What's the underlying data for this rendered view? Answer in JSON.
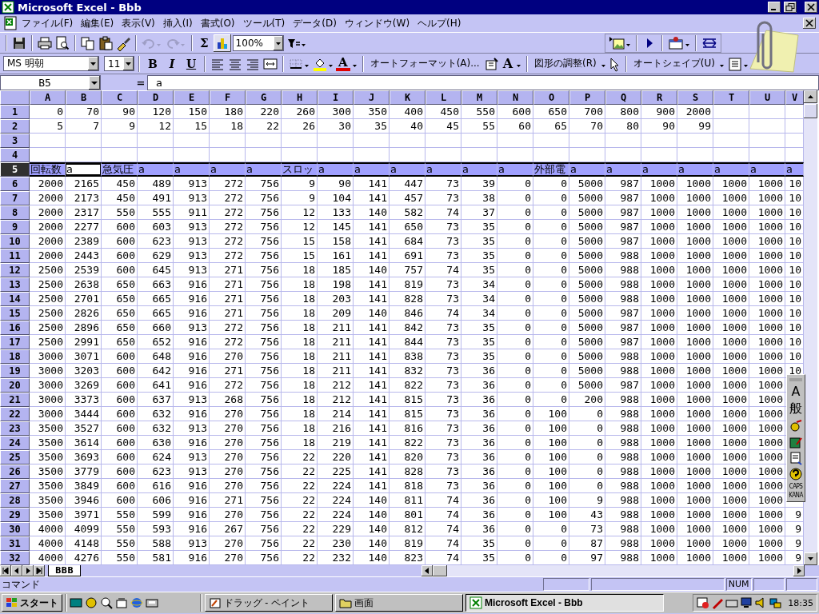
{
  "window": {
    "title": "Microsoft Excel - Bbb"
  },
  "menu": [
    "ファイル(F)",
    "編集(E)",
    "表示(V)",
    "挿入(I)",
    "書式(O)",
    "ツール(T)",
    "データ(D)",
    "ウィンドウ(W)",
    "ヘルプ(H)"
  ],
  "standard_toolbar": {
    "undo": {
      "disabled": true
    },
    "redo": {
      "disabled": true
    },
    "autosum": "Σ",
    "zoom": "100%"
  },
  "formatting_toolbar": {
    "font": "MS 明朝",
    "size": "11",
    "bold": "B",
    "italic": "I",
    "underline": "U",
    "font_color": "A",
    "autoformat": "オートフォーマット(A)...",
    "font_size": "A",
    "adjust": "図形の調整(R)",
    "autoshape": "オートシェイプ(U)"
  },
  "formula_bar": {
    "name_box": "B5",
    "equals": "=",
    "value": "a"
  },
  "sheet": {
    "columns": [
      "A",
      "B",
      "C",
      "D",
      "E",
      "F",
      "G",
      "H",
      "I",
      "J",
      "K",
      "L",
      "M",
      "N",
      "O",
      "P",
      "Q",
      "R",
      "S",
      "T",
      "U",
      "V"
    ],
    "rows": [
      {
        "number": "1",
        "selected": false,
        "kind": "numbers",
        "cells": [
          "0",
          "70",
          "90",
          "120",
          "150",
          "180",
          "220",
          "260",
          "300",
          "350",
          "400",
          "450",
          "550",
          "600",
          "650",
          "700",
          "800",
          "900",
          "2000"
        ]
      },
      {
        "number": "2",
        "selected": false,
        "kind": "numbers",
        "cells": [
          "5",
          "7",
          "9",
          "12",
          "15",
          "18",
          "22",
          "26",
          "30",
          "35",
          "40",
          "45",
          "55",
          "60",
          "65",
          "70",
          "80",
          "90",
          "99"
        ]
      },
      {
        "number": "3",
        "selected": false,
        "kind": "numbers"
      },
      {
        "number": "4",
        "selected": false,
        "kind": "numbers"
      },
      {
        "number": "5",
        "selected": true,
        "kind": "labels",
        "cells": [
          {
            "text": "回転数",
            "active": false
          },
          {
            "text": "a",
            "active": true
          },
          {
            "text": "急気圧",
            "active": false
          },
          {
            "text": "a",
            "active": false
          },
          {
            "text": "a",
            "active": false
          },
          {
            "text": "a",
            "active": false
          },
          {
            "text": "a",
            "active": false
          },
          {
            "text": "スロッ",
            "active": false
          },
          {
            "text": "a",
            "active": false
          },
          {
            "text": "a",
            "active": false
          },
          {
            "text": "a",
            "active": false
          },
          {
            "text": "a",
            "active": false
          },
          {
            "text": "a",
            "active": false
          },
          {
            "text": "a",
            "active": false
          },
          {
            "text": "外部電",
            "active": false
          },
          {
            "text": "a",
            "active": false
          },
          {
            "text": "a",
            "active": false
          },
          {
            "text": "a",
            "active": false
          },
          {
            "text": "a",
            "active": false
          },
          {
            "text": "a",
            "active": false
          },
          {
            "text": "a",
            "active": false
          },
          {
            "text": "a",
            "active": false
          }
        ]
      },
      {
        "number": "6",
        "selected": false,
        "kind": "numbers",
        "cells": [
          "2000",
          "2165",
          "450",
          "489",
          "913",
          "272",
          "756",
          "9",
          "90",
          "141",
          "447",
          "73",
          "39",
          "0",
          "0",
          "5000",
          "987",
          "1000",
          "1000",
          "1000",
          "1000",
          "10"
        ]
      },
      {
        "number": "7",
        "selected": false,
        "kind": "numbers",
        "cells": [
          "2000",
          "2173",
          "450",
          "491",
          "913",
          "272",
          "756",
          "9",
          "104",
          "141",
          "457",
          "73",
          "38",
          "0",
          "0",
          "5000",
          "987",
          "1000",
          "1000",
          "1000",
          "1000",
          "10"
        ]
      },
      {
        "number": "8",
        "selected": false,
        "kind": "numbers",
        "cells": [
          "2000",
          "2317",
          "550",
          "555",
          "911",
          "272",
          "756",
          "12",
          "133",
          "140",
          "582",
          "74",
          "37",
          "0",
          "0",
          "5000",
          "987",
          "1000",
          "1000",
          "1000",
          "1000",
          "10"
        ]
      },
      {
        "number": "9",
        "selected": false,
        "kind": "numbers",
        "cells": [
          "2000",
          "2277",
          "600",
          "603",
          "913",
          "272",
          "756",
          "12",
          "145",
          "141",
          "650",
          "73",
          "35",
          "0",
          "0",
          "5000",
          "987",
          "1000",
          "1000",
          "1000",
          "1000",
          "10"
        ]
      },
      {
        "number": "10",
        "selected": false,
        "kind": "numbers",
        "cells": [
          "2000",
          "2389",
          "600",
          "623",
          "913",
          "272",
          "756",
          "15",
          "158",
          "141",
          "684",
          "73",
          "35",
          "0",
          "0",
          "5000",
          "987",
          "1000",
          "1000",
          "1000",
          "1000",
          "10"
        ]
      },
      {
        "number": "11",
        "selected": false,
        "kind": "numbers",
        "cells": [
          "2000",
          "2443",
          "600",
          "629",
          "913",
          "272",
          "756",
          "15",
          "161",
          "141",
          "691",
          "73",
          "35",
          "0",
          "0",
          "5000",
          "988",
          "1000",
          "1000",
          "1000",
          "1000",
          "10"
        ]
      },
      {
        "number": "12",
        "selected": false,
        "kind": "numbers",
        "cells": [
          "2500",
          "2539",
          "600",
          "645",
          "913",
          "271",
          "756",
          "18",
          "185",
          "140",
          "757",
          "74",
          "35",
          "0",
          "0",
          "5000",
          "988",
          "1000",
          "1000",
          "1000",
          "1000",
          "10"
        ]
      },
      {
        "number": "13",
        "selected": false,
        "kind": "numbers",
        "cells": [
          "2500",
          "2638",
          "650",
          "663",
          "916",
          "271",
          "756",
          "18",
          "198",
          "141",
          "819",
          "73",
          "34",
          "0",
          "0",
          "5000",
          "988",
          "1000",
          "1000",
          "1000",
          "1000",
          "10"
        ]
      },
      {
        "number": "14",
        "selected": false,
        "kind": "numbers",
        "cells": [
          "2500",
          "2701",
          "650",
          "665",
          "916",
          "271",
          "756",
          "18",
          "203",
          "141",
          "828",
          "73",
          "34",
          "0",
          "0",
          "5000",
          "988",
          "1000",
          "1000",
          "1000",
          "1000",
          "10"
        ]
      },
      {
        "number": "15",
        "selected": false,
        "kind": "numbers",
        "cells": [
          "2500",
          "2826",
          "650",
          "665",
          "916",
          "271",
          "756",
          "18",
          "209",
          "140",
          "846",
          "74",
          "34",
          "0",
          "0",
          "5000",
          "987",
          "1000",
          "1000",
          "1000",
          "1000",
          "10"
        ]
      },
      {
        "number": "16",
        "selected": false,
        "kind": "numbers",
        "cells": [
          "2500",
          "2896",
          "650",
          "660",
          "913",
          "272",
          "756",
          "18",
          "211",
          "141",
          "842",
          "73",
          "35",
          "0",
          "0",
          "5000",
          "987",
          "1000",
          "1000",
          "1000",
          "1000",
          "10"
        ]
      },
      {
        "number": "17",
        "selected": false,
        "kind": "numbers",
        "cells": [
          "2500",
          "2991",
          "650",
          "652",
          "916",
          "272",
          "756",
          "18",
          "211",
          "141",
          "844",
          "73",
          "35",
          "0",
          "0",
          "5000",
          "987",
          "1000",
          "1000",
          "1000",
          "1000",
          "10"
        ]
      },
      {
        "number": "18",
        "selected": false,
        "kind": "numbers",
        "cells": [
          "3000",
          "3071",
          "600",
          "648",
          "916",
          "270",
          "756",
          "18",
          "211",
          "141",
          "838",
          "73",
          "35",
          "0",
          "0",
          "5000",
          "988",
          "1000",
          "1000",
          "1000",
          "1000",
          "10"
        ]
      },
      {
        "number": "19",
        "selected": false,
        "kind": "numbers",
        "cells": [
          "3000",
          "3203",
          "600",
          "642",
          "916",
          "271",
          "756",
          "18",
          "211",
          "141",
          "832",
          "73",
          "36",
          "0",
          "0",
          "5000",
          "988",
          "1000",
          "1000",
          "1000",
          "1000",
          "10"
        ]
      },
      {
        "number": "20",
        "selected": false,
        "kind": "numbers",
        "cells": [
          "3000",
          "3269",
          "600",
          "641",
          "916",
          "272",
          "756",
          "18",
          "212",
          "141",
          "822",
          "73",
          "36",
          "0",
          "0",
          "5000",
          "987",
          "1000",
          "1000",
          "1000",
          "1000"
        ]
      },
      {
        "number": "21",
        "selected": false,
        "kind": "numbers",
        "cells": [
          "3000",
          "3373",
          "600",
          "637",
          "913",
          "268",
          "756",
          "18",
          "212",
          "141",
          "815",
          "73",
          "36",
          "0",
          "0",
          "200",
          "988",
          "1000",
          "1000",
          "1000",
          "1000"
        ]
      },
      {
        "number": "22",
        "selected": false,
        "kind": "numbers",
        "cells": [
          "3000",
          "3444",
          "600",
          "632",
          "916",
          "270",
          "756",
          "18",
          "214",
          "141",
          "815",
          "73",
          "36",
          "0",
          "100",
          "0",
          "988",
          "1000",
          "1000",
          "1000",
          "1000"
        ]
      },
      {
        "number": "23",
        "selected": false,
        "kind": "numbers",
        "cells": [
          "3500",
          "3527",
          "600",
          "632",
          "913",
          "270",
          "756",
          "18",
          "216",
          "141",
          "816",
          "73",
          "36",
          "0",
          "100",
          "0",
          "988",
          "1000",
          "1000",
          "1000",
          "1000"
        ]
      },
      {
        "number": "24",
        "selected": false,
        "kind": "numbers",
        "cells": [
          "3500",
          "3614",
          "600",
          "630",
          "916",
          "270",
          "756",
          "18",
          "219",
          "141",
          "822",
          "73",
          "36",
          "0",
          "100",
          "0",
          "988",
          "1000",
          "1000",
          "1000",
          "1000"
        ]
      },
      {
        "number": "25",
        "selected": false,
        "kind": "numbers",
        "cells": [
          "3500",
          "3693",
          "600",
          "624",
          "913",
          "270",
          "756",
          "22",
          "220",
          "141",
          "820",
          "73",
          "36",
          "0",
          "100",
          "0",
          "988",
          "1000",
          "1000",
          "1000",
          "1000"
        ]
      },
      {
        "number": "26",
        "selected": false,
        "kind": "numbers",
        "cells": [
          "3500",
          "3779",
          "600",
          "623",
          "913",
          "270",
          "756",
          "22",
          "225",
          "141",
          "828",
          "73",
          "36",
          "0",
          "100",
          "0",
          "988",
          "1000",
          "1000",
          "1000",
          "1000"
        ]
      },
      {
        "number": "27",
        "selected": false,
        "kind": "numbers",
        "cells": [
          "3500",
          "3849",
          "600",
          "616",
          "916",
          "270",
          "756",
          "22",
          "224",
          "141",
          "818",
          "73",
          "36",
          "0",
          "100",
          "0",
          "988",
          "1000",
          "1000",
          "1000",
          "1000"
        ]
      },
      {
        "number": "28",
        "selected": false,
        "kind": "numbers",
        "cells": [
          "3500",
          "3946",
          "600",
          "606",
          "916",
          "271",
          "756",
          "22",
          "224",
          "140",
          "811",
          "74",
          "36",
          "0",
          "100",
          "9",
          "988",
          "1000",
          "1000",
          "1000",
          "1000"
        ]
      },
      {
        "number": "29",
        "selected": false,
        "kind": "numbers",
        "cells": [
          "3500",
          "3971",
          "550",
          "599",
          "916",
          "270",
          "756",
          "22",
          "224",
          "140",
          "801",
          "74",
          "36",
          "0",
          "100",
          "43",
          "988",
          "1000",
          "1000",
          "1000",
          "1000",
          "9"
        ]
      },
      {
        "number": "30",
        "selected": false,
        "kind": "numbers",
        "cells": [
          "4000",
          "4099",
          "550",
          "593",
          "916",
          "267",
          "756",
          "22",
          "229",
          "140",
          "812",
          "74",
          "36",
          "0",
          "0",
          "73",
          "988",
          "1000",
          "1000",
          "1000",
          "1000",
          "9"
        ]
      },
      {
        "number": "31",
        "selected": false,
        "kind": "numbers",
        "cells": [
          "4000",
          "4148",
          "550",
          "588",
          "913",
          "270",
          "756",
          "22",
          "230",
          "140",
          "819",
          "74",
          "35",
          "0",
          "0",
          "87",
          "988",
          "1000",
          "1000",
          "1000",
          "1000",
          "9"
        ]
      },
      {
        "number": "32",
        "selected": false,
        "kind": "numbers",
        "cells": [
          "4000",
          "4276",
          "550",
          "581",
          "916",
          "270",
          "756",
          "22",
          "232",
          "140",
          "823",
          "74",
          "35",
          "0",
          "0",
          "97",
          "988",
          "1000",
          "1000",
          "1000",
          "1000",
          "9"
        ]
      }
    ]
  },
  "sheet_tabs": [
    {
      "label": "BBB",
      "selected": true
    }
  ],
  "status_bar": {
    "text": "コマンド",
    "indicators": [
      "NUM"
    ]
  },
  "ime_toolbar": {
    "mode": "A",
    "input": "般",
    "caps": "CAPS",
    "kana": "KANA"
  },
  "taskbar": {
    "start": "スタート",
    "tasks": [
      {
        "label": "ドラッグ - ペイント",
        "selected": false
      },
      {
        "label": "画面",
        "selected": false
      },
      {
        "label": "Microsoft Excel - Bbb",
        "selected": true
      }
    ],
    "clock": "18:35"
  }
}
